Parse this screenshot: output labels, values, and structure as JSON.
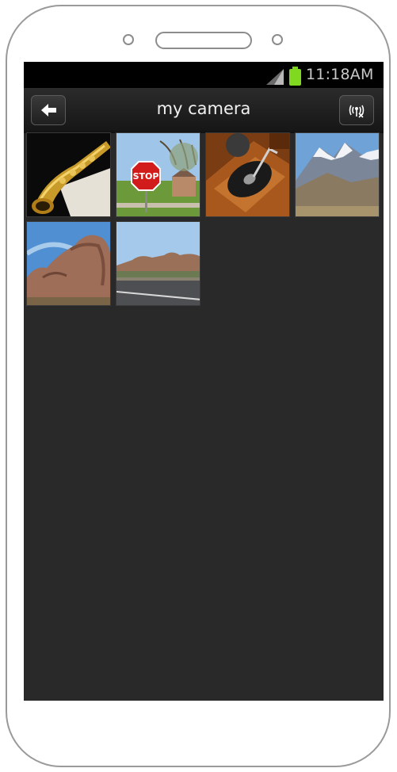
{
  "statusbar": {
    "time": "11:18AM"
  },
  "actionbar": {
    "title": "my camera"
  },
  "photos": [
    {
      "subject": "saxophone"
    },
    {
      "subject": "stop sign"
    },
    {
      "subject": "gramophone"
    },
    {
      "subject": "mountains"
    },
    {
      "subject": "rock formation"
    },
    {
      "subject": "desert road"
    }
  ],
  "colors": {
    "background": "#292929",
    "battery": "#80d820"
  },
  "icons": {
    "back": "back-arrow-icon",
    "signal": "wireless-signal-icon"
  },
  "stop_sign_text": "STOP"
}
